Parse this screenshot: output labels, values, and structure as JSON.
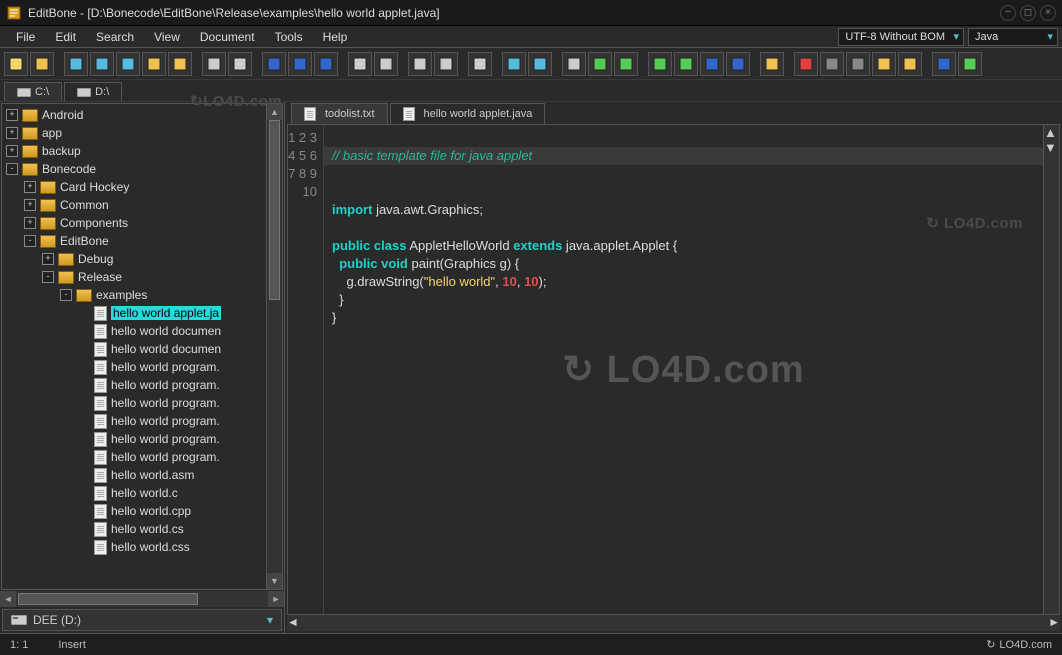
{
  "title": "EditBone - [D:\\Bonecode\\EditBone\\Release\\examples\\hello world applet.java]",
  "menus": [
    "File",
    "Edit",
    "Search",
    "View",
    "Document",
    "Tools",
    "Help"
  ],
  "encoding": "UTF-8 Without BOM",
  "language": "Java",
  "toolbar_icons": [
    "new-file",
    "open-file",
    "separator",
    "save",
    "save-as",
    "save-all",
    "open-project",
    "open-folder",
    "separator",
    "print",
    "print-preview",
    "separator",
    "bookmark-toggle",
    "bookmark-prev",
    "bookmark-next",
    "separator",
    "indent",
    "outdent",
    "separator",
    "sort-asc",
    "sort-desc",
    "separator",
    "toggle-case",
    "separator",
    "undo",
    "redo",
    "separator",
    "find",
    "find-in-files",
    "replace",
    "separator",
    "word-wrap",
    "split-horizontal",
    "split-vertical",
    "split-grid",
    "separator",
    "copy-path",
    "separator",
    "record-macro",
    "stop-macro",
    "play-macro",
    "macros",
    "compare",
    "separator",
    "preferences",
    "refresh"
  ],
  "drives": [
    {
      "label": "C:\\",
      "active": false
    },
    {
      "label": "D:\\",
      "active": true
    }
  ],
  "drive_status": "DEE (D:)",
  "tree": [
    {
      "depth": 0,
      "exp": "+",
      "type": "folder",
      "name": "Android"
    },
    {
      "depth": 0,
      "exp": "+",
      "type": "folder",
      "name": "app"
    },
    {
      "depth": 0,
      "exp": "+",
      "type": "folder",
      "name": "backup"
    },
    {
      "depth": 0,
      "exp": "-",
      "type": "folder",
      "name": "Bonecode"
    },
    {
      "depth": 1,
      "exp": "+",
      "type": "folder",
      "name": "Card Hockey"
    },
    {
      "depth": 1,
      "exp": "+",
      "type": "folder",
      "name": "Common"
    },
    {
      "depth": 1,
      "exp": "+",
      "type": "folder",
      "name": "Components"
    },
    {
      "depth": 1,
      "exp": "-",
      "type": "folder",
      "name": "EditBone"
    },
    {
      "depth": 2,
      "exp": "+",
      "type": "folder",
      "name": "Debug"
    },
    {
      "depth": 2,
      "exp": "-",
      "type": "folder",
      "name": "Release"
    },
    {
      "depth": 3,
      "exp": "-",
      "type": "folder",
      "name": "examples"
    },
    {
      "depth": 4,
      "exp": "",
      "type": "file",
      "name": "hello world applet.ja",
      "selected": true
    },
    {
      "depth": 4,
      "exp": "",
      "type": "file",
      "name": "hello world documen"
    },
    {
      "depth": 4,
      "exp": "",
      "type": "file",
      "name": "hello world documen"
    },
    {
      "depth": 4,
      "exp": "",
      "type": "file",
      "name": "hello world program."
    },
    {
      "depth": 4,
      "exp": "",
      "type": "file",
      "name": "hello world program."
    },
    {
      "depth": 4,
      "exp": "",
      "type": "file",
      "name": "hello world program."
    },
    {
      "depth": 4,
      "exp": "",
      "type": "file",
      "name": "hello world program."
    },
    {
      "depth": 4,
      "exp": "",
      "type": "file",
      "name": "hello world program."
    },
    {
      "depth": 4,
      "exp": "",
      "type": "file",
      "name": "hello world program."
    },
    {
      "depth": 4,
      "exp": "",
      "type": "file",
      "name": "hello world.asm"
    },
    {
      "depth": 4,
      "exp": "",
      "type": "file",
      "name": "hello world.c"
    },
    {
      "depth": 4,
      "exp": "",
      "type": "file",
      "name": "hello world.cpp"
    },
    {
      "depth": 4,
      "exp": "",
      "type": "file",
      "name": "hello world.cs"
    },
    {
      "depth": 4,
      "exp": "",
      "type": "file",
      "name": "hello world.css"
    }
  ],
  "file_tabs": [
    {
      "name": "todolist.txt",
      "active": false
    },
    {
      "name": "hello world applet.java",
      "active": true
    }
  ],
  "code_lines": 10,
  "code": {
    "l1": "// basic template file for java applet",
    "l3_import": "import",
    "l3_rest": " java.awt.Graphics;",
    "l5_public": "public",
    "l5_class": "class",
    "l5_name": " AppletHelloWorld ",
    "l5_extends": "extends",
    "l5_rest": " java.applet.Applet {",
    "l6_public": "public",
    "l6_void": "void",
    "l6_rest": " paint(Graphics g) {",
    "l7_pre": "    g.drawString(",
    "l7_str": "\"hello world\"",
    "l7_c": ", ",
    "l7_n1": "10",
    "l7_c2": ", ",
    "l7_n2": "10",
    "l7_end": ");",
    "l8": "  }",
    "l9": "}"
  },
  "status": {
    "pos": "1: 1",
    "mode": "Insert",
    "brand": "LO4D.com"
  },
  "watermark": "LO4D.com"
}
